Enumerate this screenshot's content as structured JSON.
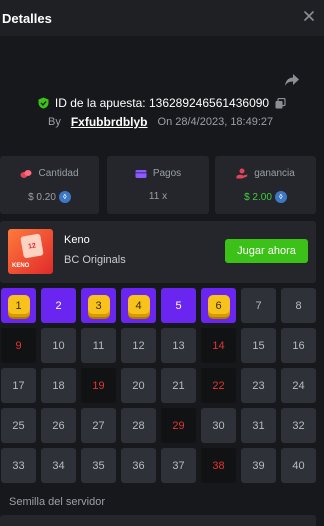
{
  "header": {
    "title": "Detalles"
  },
  "bet": {
    "id_label": "ID de la apuesta:",
    "id_value": "136289246561436090",
    "by_label": "By",
    "user": "Fxfubbrdblyb",
    "on_label": "On",
    "datetime": "28/4/2023, 18:49:27"
  },
  "stats": {
    "amount": {
      "label": "Cantidad",
      "value": "$ 0.20",
      "icon": "coins-icon"
    },
    "payout": {
      "label": "Pagos",
      "value": "11 x",
      "icon": "payout-card-icon"
    },
    "profit": {
      "label": "ganancia",
      "value": "$ 2.00",
      "icon": "profit-hand-icon"
    }
  },
  "game": {
    "name": "Keno",
    "provider": "BC Originals",
    "thumb_card": "12",
    "thumb_label": "KENO",
    "play_label": "Jugar ahora"
  },
  "tiles": [
    {
      "n": "1",
      "state": "hit"
    },
    {
      "n": "2",
      "state": "picked"
    },
    {
      "n": "3",
      "state": "hit"
    },
    {
      "n": "4",
      "state": "hit"
    },
    {
      "n": "5",
      "state": "picked"
    },
    {
      "n": "6",
      "state": "hit"
    },
    {
      "n": "7",
      "state": "normal"
    },
    {
      "n": "8",
      "state": "normal"
    },
    {
      "n": "9",
      "state": "drawn"
    },
    {
      "n": "10",
      "state": "normal"
    },
    {
      "n": "11",
      "state": "normal"
    },
    {
      "n": "12",
      "state": "normal"
    },
    {
      "n": "13",
      "state": "normal"
    },
    {
      "n": "14",
      "state": "drawn"
    },
    {
      "n": "15",
      "state": "normal"
    },
    {
      "n": "16",
      "state": "normal"
    },
    {
      "n": "17",
      "state": "normal"
    },
    {
      "n": "18",
      "state": "normal"
    },
    {
      "n": "19",
      "state": "drawn"
    },
    {
      "n": "20",
      "state": "normal"
    },
    {
      "n": "21",
      "state": "normal"
    },
    {
      "n": "22",
      "state": "drawn"
    },
    {
      "n": "23",
      "state": "normal"
    },
    {
      "n": "24",
      "state": "normal"
    },
    {
      "n": "25",
      "state": "normal"
    },
    {
      "n": "26",
      "state": "normal"
    },
    {
      "n": "27",
      "state": "normal"
    },
    {
      "n": "28",
      "state": "normal"
    },
    {
      "n": "29",
      "state": "drawn"
    },
    {
      "n": "30",
      "state": "normal"
    },
    {
      "n": "31",
      "state": "normal"
    },
    {
      "n": "32",
      "state": "normal"
    },
    {
      "n": "33",
      "state": "normal"
    },
    {
      "n": "34",
      "state": "normal"
    },
    {
      "n": "35",
      "state": "normal"
    },
    {
      "n": "36",
      "state": "normal"
    },
    {
      "n": "37",
      "state": "normal"
    },
    {
      "n": "38",
      "state": "drawn"
    },
    {
      "n": "39",
      "state": "normal"
    },
    {
      "n": "40",
      "state": "normal"
    }
  ],
  "seed": {
    "label": "Semilla del servidor"
  },
  "colors": {
    "accent_green": "#3bc117",
    "picked_purple": "#6a25f0",
    "hit_gold": "#f7c21a",
    "drawn_red": "#e23434"
  }
}
